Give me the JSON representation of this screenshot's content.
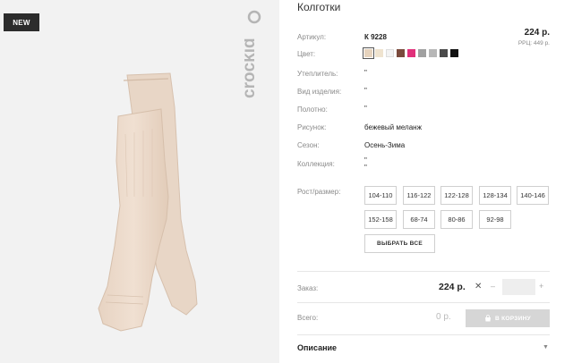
{
  "badge": "NEW",
  "brand": "crockid",
  "product": {
    "title": "Колготки",
    "price": "224 р.",
    "rrp": "РРЦ: 449 р."
  },
  "details": [
    {
      "label": "Артикул:",
      "value": "К 9228"
    },
    {
      "label": "Цвет:",
      "value": ""
    },
    {
      "label": "Утеплитель:",
      "value": "\""
    },
    {
      "label": "Вид изделия:",
      "value": "\""
    },
    {
      "label": "Полотно:",
      "value": "\""
    },
    {
      "label": "Рисунок:",
      "value": "бежевый меланж"
    },
    {
      "label": "Сезон:",
      "value": "Осень-Зима"
    },
    {
      "label": "Коллекция:",
      "value": "\"\n\""
    },
    {
      "label": "Рост/размер:",
      "value": ""
    }
  ],
  "colors": [
    "#e6d3bd",
    "#efe3cf",
    "#f3f3f3",
    "#7a4a3c",
    "#e0307a",
    "#a0a0a0",
    "#b7b7b7",
    "#4a4a4a",
    "#111111"
  ],
  "selected_color_index": 0,
  "sizes": [
    "104-110",
    "116-122",
    "122-128",
    "128-134",
    "140-146",
    "152-158",
    "68-74",
    "80-86",
    "92-98"
  ],
  "select_all_label": "ВЫБРАТЬ ВСЕ",
  "order": {
    "label": "Заказ:",
    "price": "224 р.",
    "times": "✕",
    "minus": "–",
    "plus": "+",
    "quantity": ""
  },
  "total": {
    "label": "Всего:",
    "value": "0 р.",
    "cart_label": "В КОРЗИНУ"
  },
  "description_label": "Описание"
}
